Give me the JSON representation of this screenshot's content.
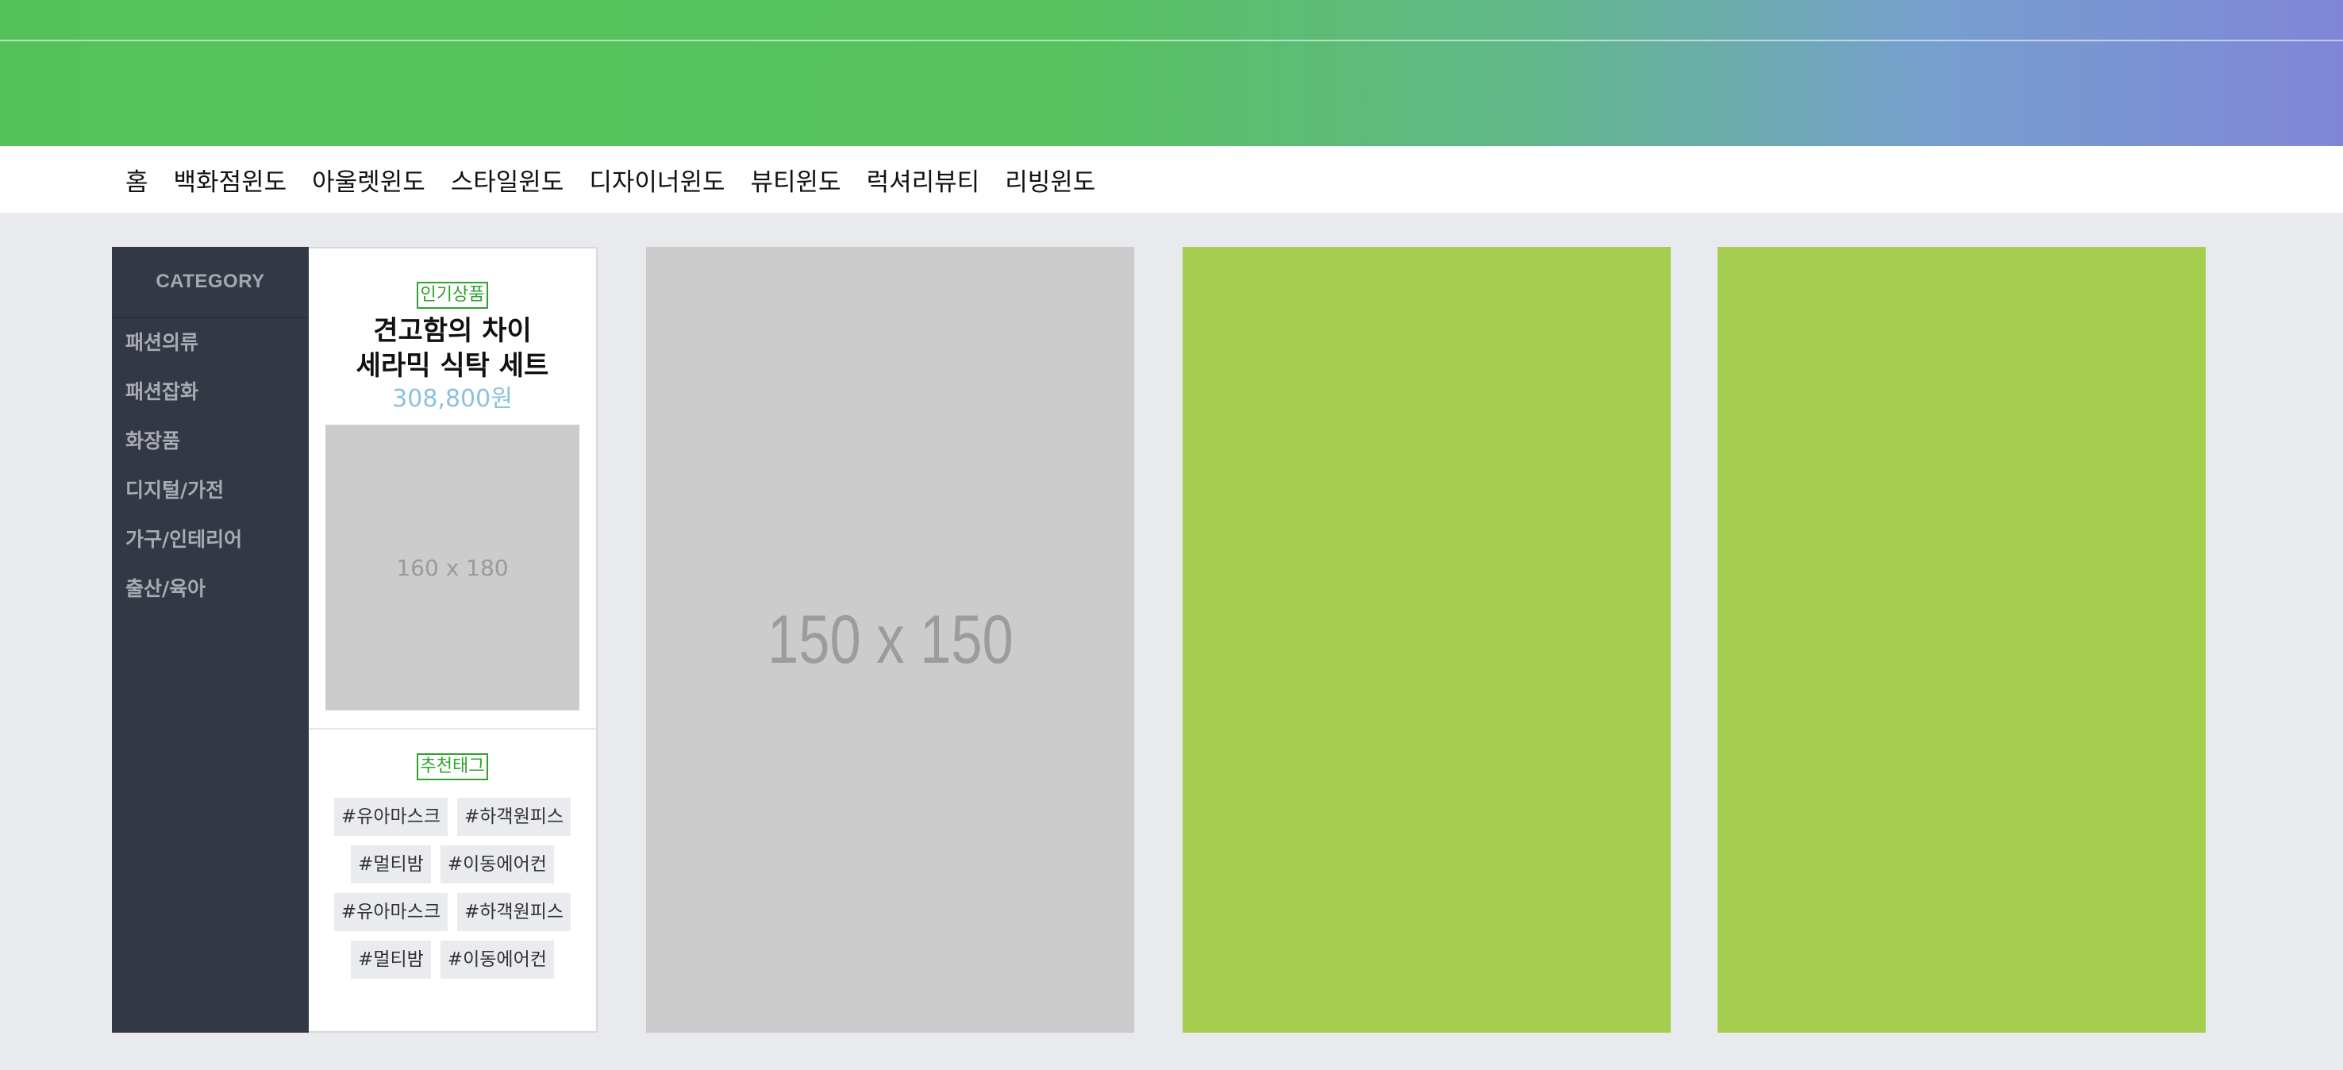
{
  "nav": {
    "items": [
      "홈",
      "백화점윈도",
      "아울렛윈도",
      "스타일윈도",
      "디자이너윈도",
      "뷰티윈도",
      "럭셔리뷰티",
      "리빙윈도"
    ]
  },
  "category": {
    "title": "CATEGORY",
    "items": [
      "패션의류",
      "패션잡화",
      "화장품",
      "디지털/가전",
      "가구/인테리어",
      "출산/육아"
    ]
  },
  "promo": {
    "badge": "인기상품",
    "title_line1": "견고함의 차이",
    "title_line2": "세라믹 식탁 세트",
    "price": "308,800원",
    "image_placeholder": "160 x 180",
    "tags_badge": "추천태그",
    "tags": [
      "#유아마스크",
      "#하객원피스",
      "#멀티밤",
      "#이동에어컨",
      "#유아마스크",
      "#하객원피스",
      "#멀티밤",
      "#이동에어컨"
    ]
  },
  "cards": {
    "gray_placeholder": "150 x 150"
  },
  "colors": {
    "accent_green": "#2fa12f",
    "price_blue": "#8cc0e3",
    "card_green": "#a5cd50",
    "sidebar_dark": "#333845"
  }
}
